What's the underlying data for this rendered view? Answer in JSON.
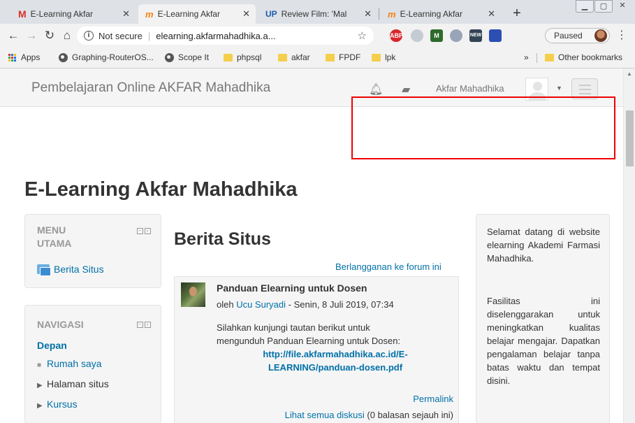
{
  "browser": {
    "tabs": [
      {
        "title": "E-Learning Akfar",
        "favicon": "gmail-icon",
        "active": false
      },
      {
        "title": "E-Learning Akfar",
        "favicon": "moodle-icon",
        "active": true
      },
      {
        "title": "Review Film: 'Mal",
        "favicon": "up-icon",
        "active": false
      },
      {
        "title": "E-Learning Akfar",
        "favicon": "moodle-icon",
        "active": false
      }
    ],
    "new_tab": "+",
    "security_label": "Not secure",
    "url": "elearning.akfarmahadhika.a...",
    "profile_status": "Paused",
    "bookmarks": [
      "Apps",
      "Graphing-RouterOS...",
      "Scope It",
      "phpsql",
      "akfar",
      "FPDF",
      "lpk"
    ],
    "overflow": "»",
    "other_bookmarks": "Other bookmarks"
  },
  "navbar": {
    "brand": "Pembelajaran Online AKFAR Mahadhika",
    "user_name": "Akfar Mahadhika"
  },
  "page": {
    "title": "E-Learning Akfar Mahadhika"
  },
  "menu_block": {
    "title_line1": "MENU",
    "title_line2": "UTAMA",
    "item": "Berita Situs"
  },
  "nav_block": {
    "title": "NAVIGASI",
    "home": "Depan",
    "items": [
      "Rumah saya",
      "Halaman situs",
      "Kursus"
    ]
  },
  "main": {
    "title": "Berita Situs",
    "subscribe_link": "Berlangganan ke forum ini",
    "post": {
      "subject": "Panduan Elearning untuk Dosen",
      "by_prefix": "oleh",
      "author": "Ucu Suryadi",
      "date": "- Senin, 8 Juli 2019, 07:34",
      "body_line1": "Silahkan kunjungi tautan berikut untuk",
      "body_line2": "mengunduh Panduan Elearning untuk Dosen:",
      "link_line1": "http://file.akfarmahadhika.ac.id/E-",
      "link_line2": "LEARNING/panduan-dosen.pdf",
      "permalink": "Permalink",
      "discussion_link": "Lihat semua diskusi",
      "discussion_count": " (0 balasan sejauh ini)"
    }
  },
  "welcome_block": {
    "para1": "Selamat datang di website elearning Akademi Farmasi Mahadhika.",
    "para2": "Fasilitas ini diselenggarakan untuk meningkatkan kualitas belajar mengajar. Dapatkan pengalaman belajar tanpa batas waktu dan tempat disini."
  },
  "colors": {
    "link": "#0070a8",
    "highlight": "#ee0000",
    "navbar_bg": "#f5f5f5"
  }
}
